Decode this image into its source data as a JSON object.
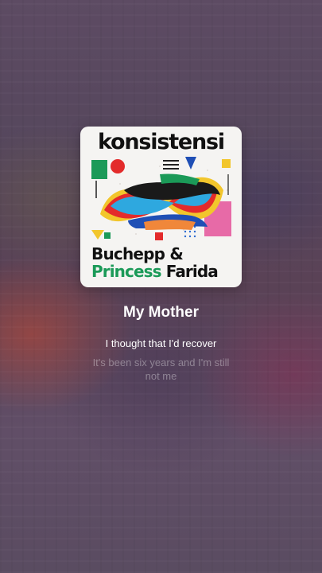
{
  "album": {
    "cover_title": "konsistensi",
    "artist_line1": "Buchepp &",
    "artist_line2_green": "Princess",
    "artist_line2_dark": "Farida"
  },
  "track": {
    "title": "My Mother"
  },
  "lyrics": {
    "current": "I thought that I'd recover",
    "next": "It's been six years and I'm still not me"
  }
}
